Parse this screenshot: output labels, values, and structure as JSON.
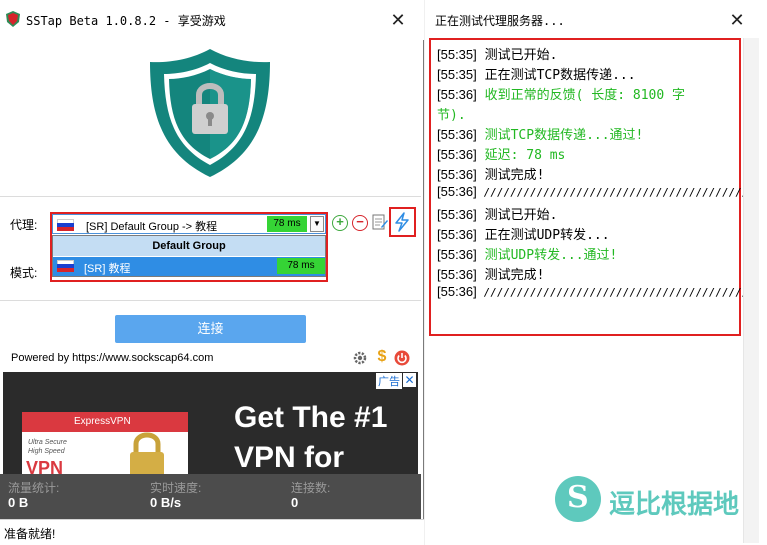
{
  "main_window": {
    "title": "SSTap Beta 1.0.8.2 - 享受游戏",
    "close_glyph": "✕",
    "proxy_label": "代理:",
    "mode_label": "模式:",
    "selected_proxy": "[SR] Default Group -> 教程",
    "selected_ping": "78 ms",
    "dropdown": {
      "group": "Default Group",
      "item_label": "[SR] 教程",
      "item_ping": "78 ms"
    },
    "connect_label": "连接",
    "powered_by": "Powered by https://www.sockscap64.com",
    "ad": {
      "tag": "广告",
      "close": "✕",
      "brand": "ExpressVPN",
      "card_small": "Ultra Secure\nHigh Speed",
      "card_big": "VPN",
      "headline_1": "Get The #1",
      "headline_2": "VPN for"
    },
    "stats": {
      "traffic_label": "流量统计:",
      "traffic_value": "0 B",
      "speed_label": "实时速度:",
      "speed_value": "0 B/s",
      "connections_label": "连接数:",
      "connections_value": "0"
    },
    "status": "准备就绪!"
  },
  "test_window": {
    "title": "正在测试代理服务器...",
    "close_glyph": "✕",
    "log": [
      {
        "time": "[55:35]",
        "msg": "测试已开始.",
        "green": false
      },
      {
        "time": "[55:35]",
        "msg": "正在测试TCP数据传递...",
        "green": false
      },
      {
        "time": "[55:36]",
        "msg": "收到正常的反馈( 长度: 8100 字",
        "green": true
      },
      {
        "time": "",
        "msg": "节).",
        "green": true
      },
      {
        "time": "[55:36]",
        "msg": "测试TCP数据传递...通过!",
        "green": true
      },
      {
        "time": "[55:36]",
        "msg": "延迟: 78 ms",
        "green": true
      },
      {
        "time": "[55:36]",
        "msg": "测试完成!",
        "green": false
      },
      {
        "time": "[55:36]",
        "msg": "////////////////////////////////////////",
        "green": false
      },
      {
        "time": "[55:36]",
        "msg": "测试已开始.",
        "green": false
      },
      {
        "time": "[55:36]",
        "msg": "正在测试UDP转发...",
        "green": false
      },
      {
        "time": "[55:36]",
        "msg": "测试UDP转发...通过!",
        "green": true
      },
      {
        "time": "[55:36]",
        "msg": "测试完成!",
        "green": false
      },
      {
        "time": "[55:36]",
        "msg": "////////////////////////////////////////",
        "green": false
      }
    ]
  },
  "watermark": {
    "logo_letter": "S",
    "text": "逗比根据地"
  },
  "colors": {
    "accent_blue": "#5aa6ee",
    "ping_green": "#35d435",
    "log_green": "#22b822",
    "highlight_red": "#e02020",
    "shield_teal": "#14857d",
    "watermark_teal": "#5ec9bd"
  }
}
